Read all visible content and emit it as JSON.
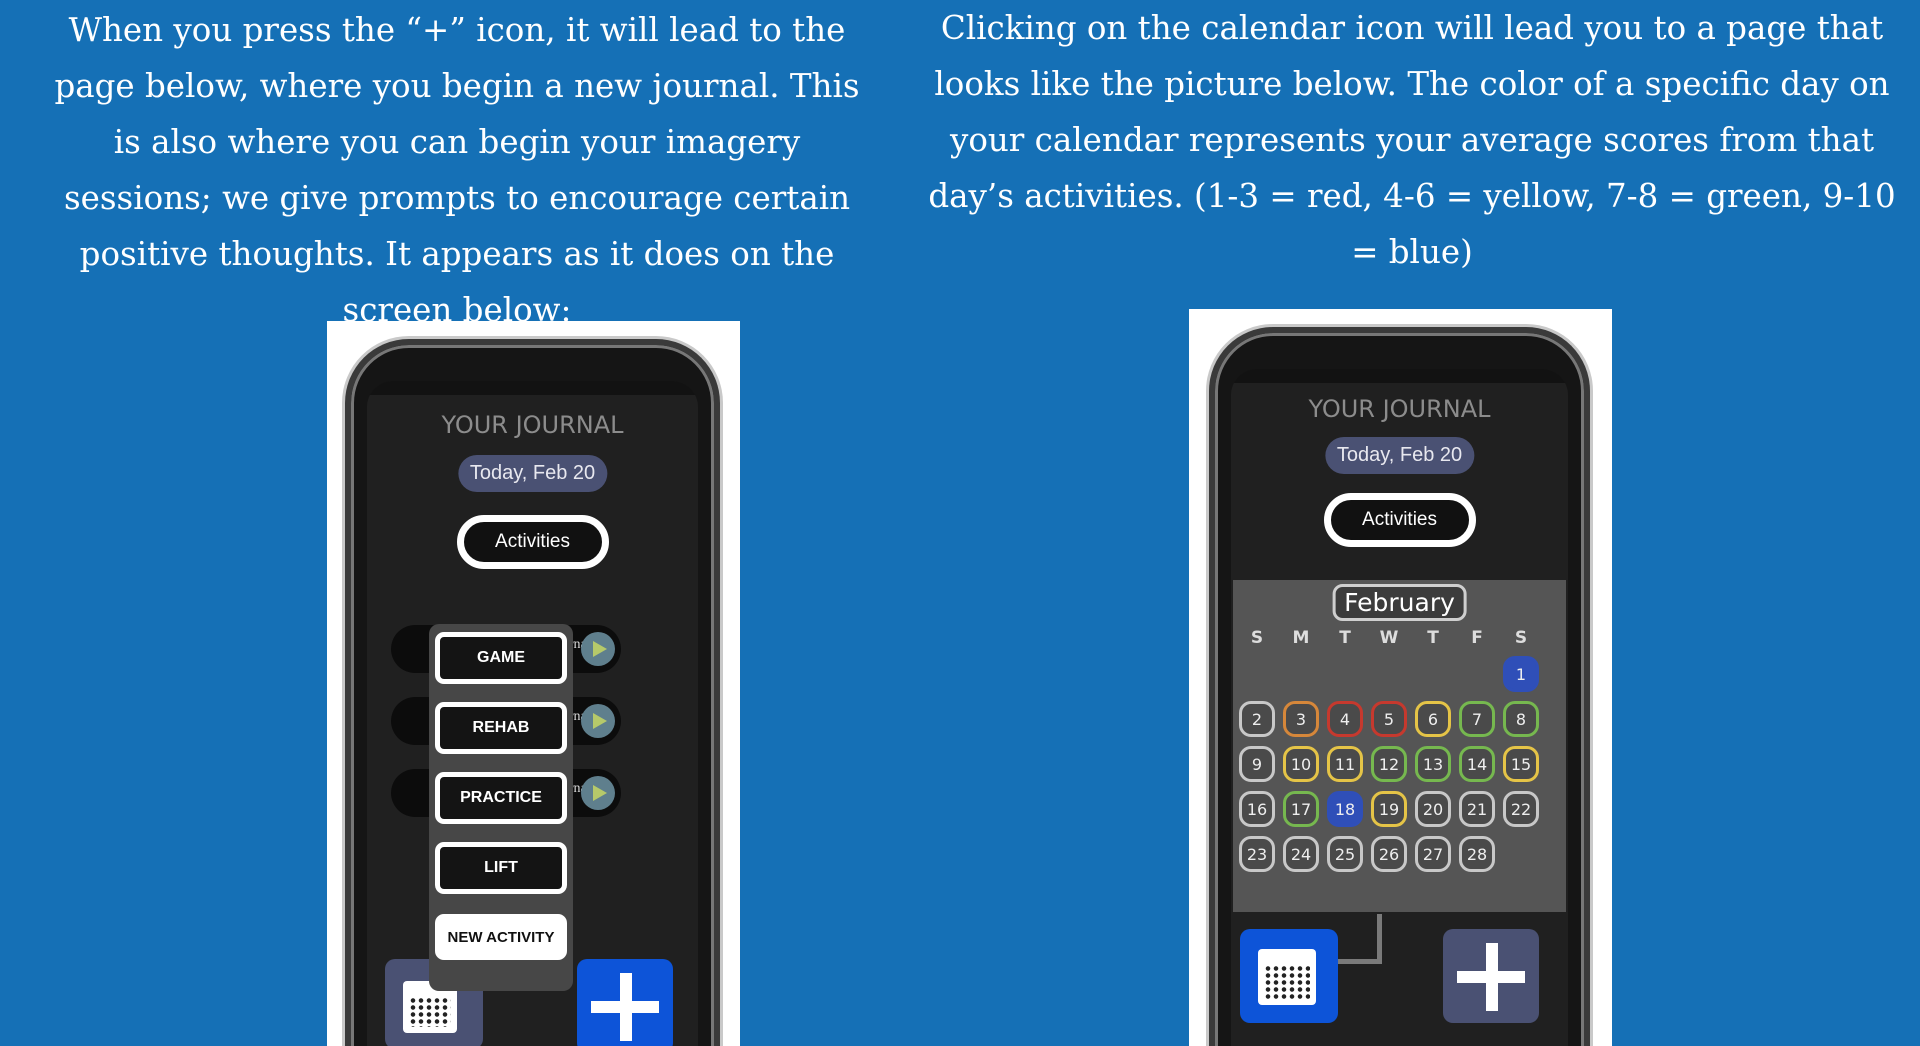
{
  "left_caption": "When you press the “+” icon, it will lead to the  page below, where you begin a new journal. This is also where you can begin your imagery sessions; we give prompts to encourage certain positive thoughts. It appears as it does on the screen below:",
  "right_caption": "Clicking on the calendar icon will lead you to a page that looks like the picture below. The color of a specific day on your calendar represents your average scores from that day’s activities. (1-3 = red, 4-6 = yellow, 7-8 = green, 9-10 = blue)",
  "left_phone": {
    "title": "YOUR JOURNAL",
    "date": "Today, Feb 20",
    "activities_label": "Activities",
    "journal_rows": [
      "journal",
      "journal",
      "journal"
    ],
    "menu": [
      "GAME",
      "REHAB",
      "PRACTICE",
      "LIFT",
      "NEW ACTIVITY"
    ]
  },
  "right_phone": {
    "title": "YOUR JOURNAL",
    "date": "Today, Feb 20",
    "activities_label": "Activities",
    "month": "February",
    "weekdays": [
      "S",
      "M",
      "T",
      "W",
      "T",
      "F",
      "S"
    ],
    "days": [
      {
        "d": "1",
        "c": "blue"
      },
      {
        "d": "2",
        "c": "gray"
      },
      {
        "d": "3",
        "c": "orange"
      },
      {
        "d": "4",
        "c": "red"
      },
      {
        "d": "5",
        "c": "red"
      },
      {
        "d": "6",
        "c": "yellow"
      },
      {
        "d": "7",
        "c": "green"
      },
      {
        "d": "8",
        "c": "green"
      },
      {
        "d": "9",
        "c": "gray"
      },
      {
        "d": "10",
        "c": "yellow"
      },
      {
        "d": "11",
        "c": "yellow"
      },
      {
        "d": "12",
        "c": "green"
      },
      {
        "d": "13",
        "c": "green"
      },
      {
        "d": "14",
        "c": "green"
      },
      {
        "d": "15",
        "c": "yellow"
      },
      {
        "d": "16",
        "c": "gray"
      },
      {
        "d": "17",
        "c": "green"
      },
      {
        "d": "18",
        "c": "blue"
      },
      {
        "d": "19",
        "c": "yellow"
      },
      {
        "d": "20",
        "c": "gray"
      },
      {
        "d": "21",
        "c": "gray"
      },
      {
        "d": "22",
        "c": "gray"
      },
      {
        "d": "23",
        "c": "gray"
      },
      {
        "d": "24",
        "c": "gray"
      },
      {
        "d": "25",
        "c": "gray"
      },
      {
        "d": "26",
        "c": "gray"
      },
      {
        "d": "27",
        "c": "gray"
      },
      {
        "d": "28",
        "c": "gray"
      }
    ]
  },
  "colors": {
    "background": "#1570b6",
    "plus_button": "#0d54d8",
    "red": "#c6392e",
    "yellow": "#e5c447",
    "green": "#76b84f",
    "blue": "#2f4fb8"
  },
  "icons": [
    "plus-icon",
    "calendar-icon",
    "arrow-right-icon"
  ]
}
